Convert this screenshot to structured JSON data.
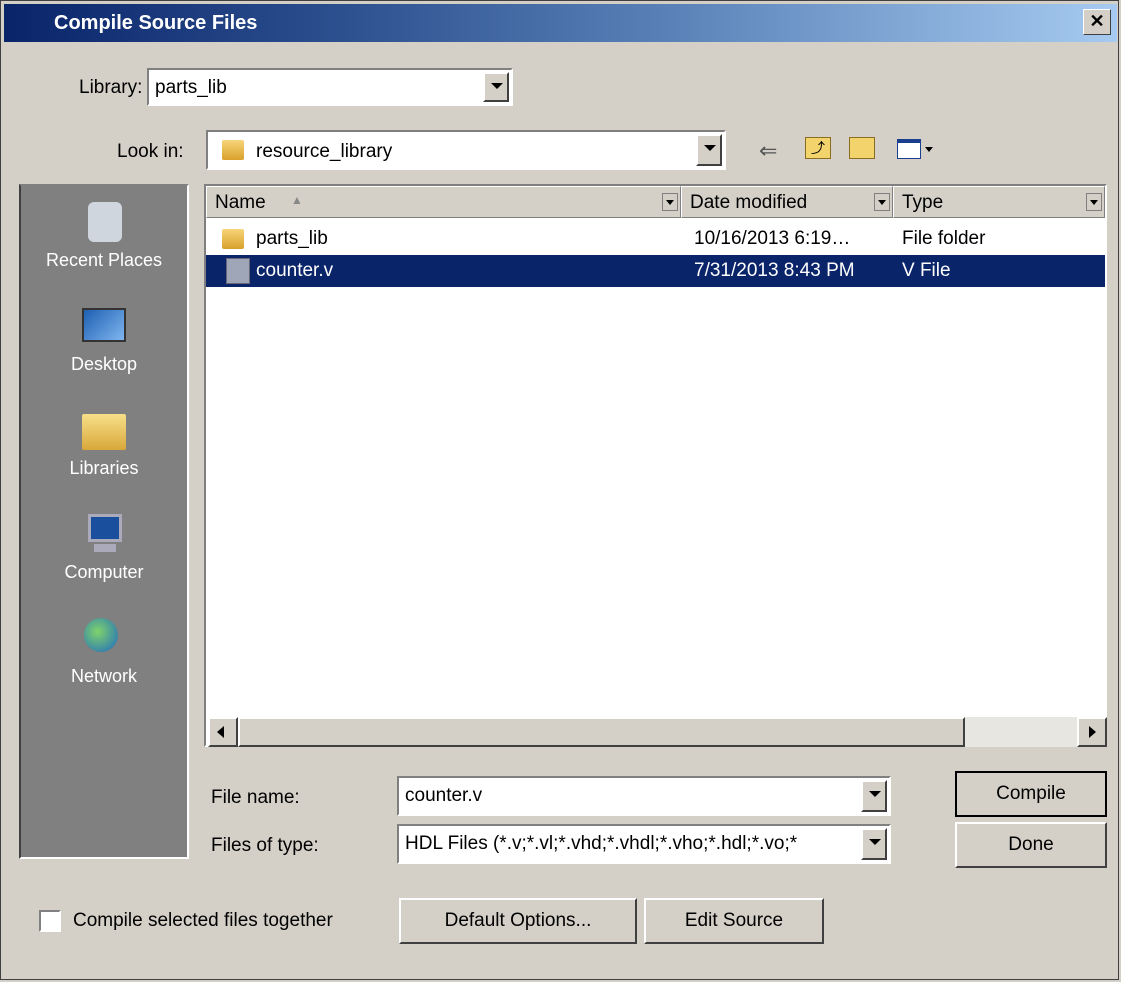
{
  "window": {
    "title": "Compile Source Files"
  },
  "library": {
    "label": "Library:",
    "value": "parts_lib"
  },
  "look_in": {
    "label": "Look in:",
    "value": "resource_library"
  },
  "places": [
    {
      "label": "Recent Places",
      "icon": "recent-places-icon"
    },
    {
      "label": "Desktop",
      "icon": "desktop-icon"
    },
    {
      "label": "Libraries",
      "icon": "libraries-icon"
    },
    {
      "label": "Computer",
      "icon": "computer-icon"
    },
    {
      "label": "Network",
      "icon": "network-icon"
    }
  ],
  "columns": [
    "Name",
    "Date modified",
    "Type"
  ],
  "files": [
    {
      "name": "parts_lib",
      "date": "10/16/2013 6:19…",
      "type": "File folder",
      "icon": "folder-icon",
      "selected": false
    },
    {
      "name": "counter.v",
      "date": "7/31/2013 8:43 PM",
      "type": "V File",
      "icon": "file-icon",
      "selected": true
    }
  ],
  "file_name": {
    "label": "File name:",
    "value": "counter.v"
  },
  "files_of_type": {
    "label": "Files of type:",
    "value": "HDL Files (*.v;*.vl;*.vhd;*.vhdl;*.vho;*.hdl;*.vo;*"
  },
  "buttons": {
    "compile": "Compile",
    "done": "Done",
    "default_options": "Default Options...",
    "edit_source": "Edit Source"
  },
  "compile_together": {
    "label": "Compile selected files together",
    "checked": false
  },
  "colors": {
    "selection": "#0a246a",
    "face": "#d4d0c8",
    "places_bg": "#808080"
  }
}
